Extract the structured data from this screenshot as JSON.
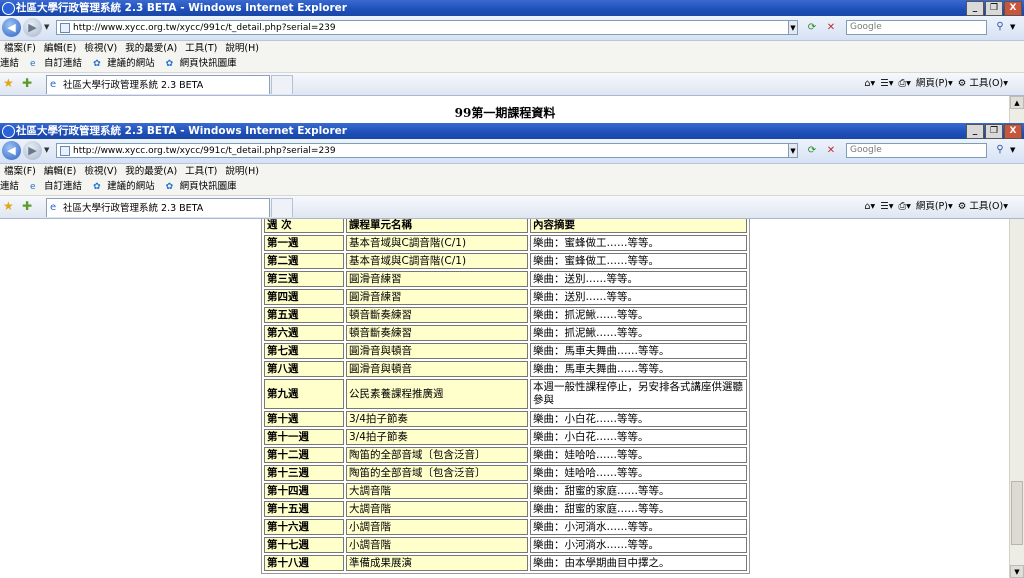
{
  "window": {
    "title": "社區大學行政管理系統 2.3 BETA - Windows Internet Explorer",
    "controls": [
      "_",
      "❐",
      "X"
    ]
  },
  "address": {
    "url": "http://www.xycc.org.tw/xycc/991c/t_detail.php?serial=239"
  },
  "search": {
    "placeholder": "Google"
  },
  "menu": [
    "檔案(F)",
    "編輯(E)",
    "檢視(V)",
    "我的最愛(A)",
    "工具(T)",
    "說明(H)"
  ],
  "links": {
    "label": "連結",
    "items": [
      "自訂連結",
      "建議的網站",
      "網頁快訊圖庫"
    ]
  },
  "tab": {
    "title": "社區大學行政管理系統 2.3 BETA"
  },
  "commands": {
    "page": "網頁(P)",
    "tools": "工具(O)"
  },
  "page": {
    "title": "99第一期課程資料"
  },
  "table": {
    "headers": [
      "週 次",
      "課程單元名稱",
      "內容摘要"
    ],
    "rows": [
      [
        "第一週",
        "基本音域與C調音階(C/1)",
        "樂曲：蜜蜂做工……等等。"
      ],
      [
        "第二週",
        "基本音域與C調音階(C/1)",
        "樂曲：蜜蜂做工……等等。"
      ],
      [
        "第三週",
        "圓滑音練習",
        "樂曲：送別……等等。"
      ],
      [
        "第四週",
        "圓滑音練習",
        "樂曲：送別……等等。"
      ],
      [
        "第五週",
        "頓音斷奏練習",
        "樂曲：抓泥鰍……等等。"
      ],
      [
        "第六週",
        "頓音斷奏練習",
        "樂曲：抓泥鰍……等等。"
      ],
      [
        "第七週",
        "圓滑音與頓音",
        "樂曲：馬車夫舞曲……等等。"
      ],
      [
        "第八週",
        "圓滑音與頓音",
        "樂曲：馬車夫舞曲……等等。"
      ],
      [
        "第九週",
        "公民素養課程推廣週",
        "本週一般性課程停止，另安排各式講座供選聽參與"
      ],
      [
        "第十週",
        "3/4拍子節奏",
        "樂曲：小白花……等等。"
      ],
      [
        "第十一週",
        "3/4拍子節奏",
        "樂曲：小白花……等等。"
      ],
      [
        "第十二週",
        "陶笛的全部音域〔包含泛音〕",
        "樂曲：娃哈哈……等等。"
      ],
      [
        "第十三週",
        "陶笛的全部音域〔包含泛音〕",
        "樂曲：娃哈哈……等等。"
      ],
      [
        "第十四週",
        "大調音階",
        "樂曲：甜蜜的家庭……等等。"
      ],
      [
        "第十五週",
        "大調音階",
        "樂曲：甜蜜的家庭……等等。"
      ],
      [
        "第十六週",
        "小調音階",
        "樂曲：小河淌水……等等。"
      ],
      [
        "第十七週",
        "小調音階",
        "樂曲：小河淌水……等等。"
      ],
      [
        "第十八週",
        "準備成果展演",
        "樂曲：由本學期曲目中擇之。"
      ]
    ]
  }
}
